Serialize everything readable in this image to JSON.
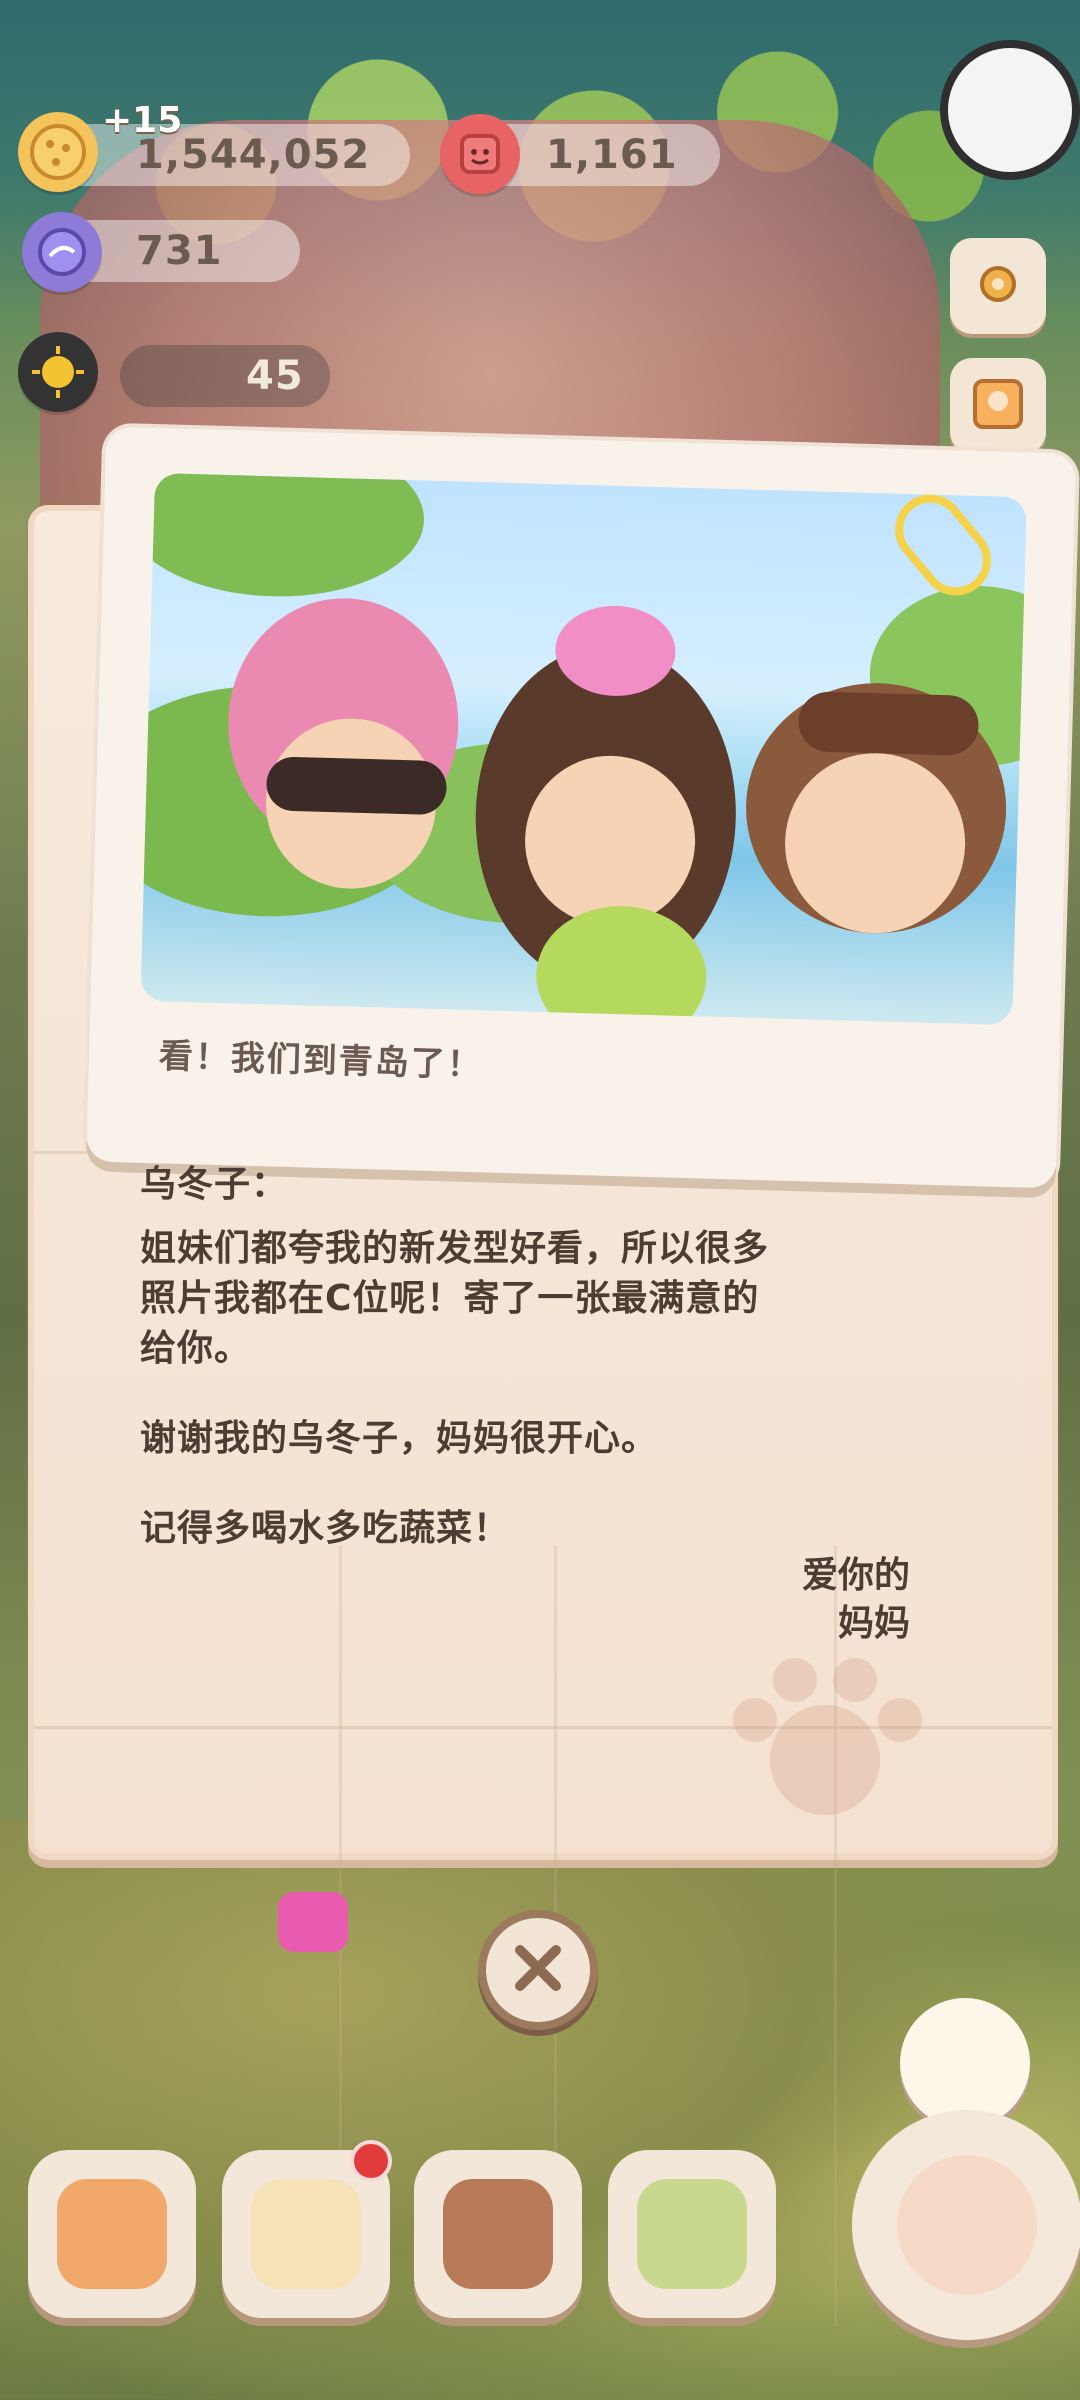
{
  "hud": {
    "coins": "1,544,052",
    "coin_gain": "+15",
    "gems": "1,161",
    "crystals": "731",
    "sun_count": "45"
  },
  "letter": {
    "photo_caption": "看！我们到青岛了！",
    "salutation": "乌冬子：",
    "paragraph_1": "姐妹们都夸我的新发型好看，所以很多\n照片我都在C位呢！寄了一张最满意的\n给你。",
    "paragraph_2": "谢谢我的乌冬子，妈妈很开心。",
    "paragraph_3": "记得多喝水多吃蔬菜！",
    "signature_line1": "爱你的",
    "signature_line2": "妈妈"
  },
  "icons": {
    "coin": "cookie-coin-icon",
    "gem": "red-gem-icon",
    "crystal": "purple-crystal-icon",
    "sun": "sun-icon",
    "settings": "gear-icon",
    "close": "close-icon"
  },
  "colors": {
    "paper": "#f8eadd",
    "text": "#4b3c34",
    "badge": "#e23b3b"
  }
}
